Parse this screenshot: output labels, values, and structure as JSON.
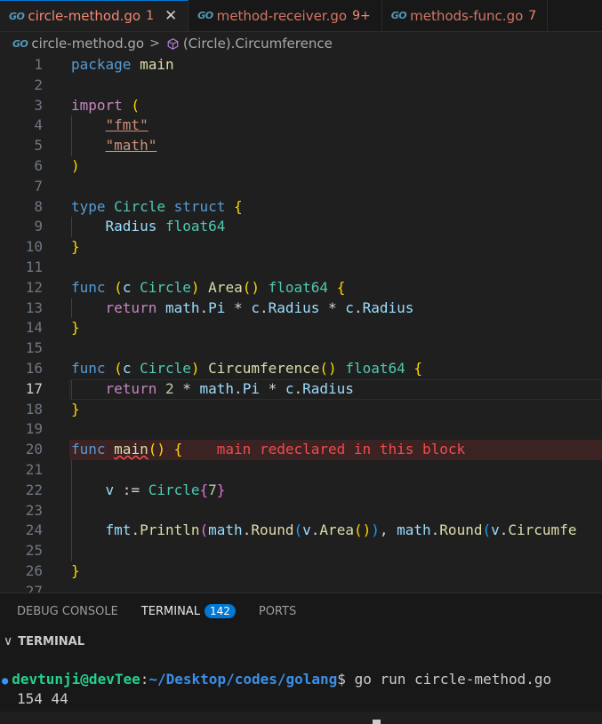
{
  "tabs": [
    {
      "name": "circle-method.go",
      "count": "1",
      "close": "✕"
    },
    {
      "name": "method-receiver.go",
      "count": "9+"
    },
    {
      "name": "methods-func.go",
      "count": "7"
    }
  ],
  "go_icon": "GO",
  "breadcrumb": {
    "file": "circle-method.go",
    "separator": ">",
    "symbol": "(Circle).Circumference"
  },
  "editor": {
    "current_line": 17,
    "error_line": 20,
    "line_numbers": [
      "1",
      "2",
      "3",
      "4",
      "5",
      "6",
      "7",
      "8",
      "9",
      "10",
      "11",
      "12",
      "13",
      "14",
      "15",
      "16",
      "17",
      "18",
      "19",
      "20",
      "21",
      "22",
      "23",
      "24",
      "25",
      "26",
      "27"
    ],
    "code": {
      "l1": {
        "a": "package",
        "b": " main"
      },
      "l3": {
        "a": "import",
        "b": " ("
      },
      "l4": "\"fmt\"",
      "l5": "\"math\"",
      "l6": ")",
      "l8": {
        "a": "type",
        "b": "Circle",
        "c": "struct",
        "d": "{"
      },
      "l9": {
        "a": "Radius",
        "b": "float64"
      },
      "l10": "}",
      "l12": {
        "a": "func",
        "b": "(",
        "c": "c",
        "d": "Circle",
        "e": ")",
        "f": "Area",
        "g": "()",
        "h": "float64",
        "i": "{"
      },
      "l13": {
        "a": "return",
        "b": "math",
        "c": ".",
        "d": "Pi",
        "e": " * ",
        "f": "c",
        "g": ".",
        "h": "Radius",
        "i": " * ",
        "j": "c",
        "k": ".",
        "l": "Radius"
      },
      "l14": "}",
      "l16": {
        "a": "func",
        "b": "(",
        "c": "c",
        "d": "Circle",
        "e": ")",
        "f": "Circumference",
        "g": "()",
        "h": "float64",
        "i": "{"
      },
      "l17": {
        "a": "return",
        "b": "2",
        "c": " * ",
        "d": "math",
        "e": ".",
        "f": "Pi",
        "g": " * ",
        "h": "c",
        "i": ".",
        "j": "Radius"
      },
      "l18": "}",
      "l20": {
        "a": "func",
        "b": "main",
        "c": "()",
        "d": "{"
      },
      "l22": {
        "a": "v",
        "b": " := ",
        "c": "Circle",
        "d": "{",
        "e": "7",
        "f": "}"
      },
      "l24": {
        "a": "fmt",
        "b": ".",
        "c": "Println",
        "d": "(",
        "e": "math",
        "f": ".",
        "g": "Round",
        "h": "(",
        "i": "v",
        "j": ".",
        "k": "Area",
        "l": "()",
        "m": ")",
        "n": ", ",
        "o": "math",
        "p": ".",
        "q": "Round",
        "r": "(",
        "s": "v",
        "t": ".",
        "u": "Circumfe"
      },
      "l26": "}"
    },
    "error_message": "main redeclared in this block"
  },
  "panel": {
    "tabs": [
      {
        "label": "DEBUG CONSOLE"
      },
      {
        "label": "TERMINAL",
        "badge": "142"
      },
      {
        "label": "PORTS"
      }
    ],
    "terminal_header": "TERMINAL",
    "chevron": "∨"
  },
  "terminal": {
    "dot": "●",
    "user": "devtunji@devTee",
    "colon": ":",
    "path": "~/Desktop/codes/golang",
    "prompt": "$",
    "command": " go run circle-method.go",
    "output": "154 44"
  },
  "colors": {
    "accent": "#0078d4",
    "error": "#f14c4c",
    "tab_warning": "#f48771",
    "keyword": "#569cd6",
    "type": "#4ec9b0",
    "function": "#dcdcaa",
    "string": "#ce9178"
  }
}
